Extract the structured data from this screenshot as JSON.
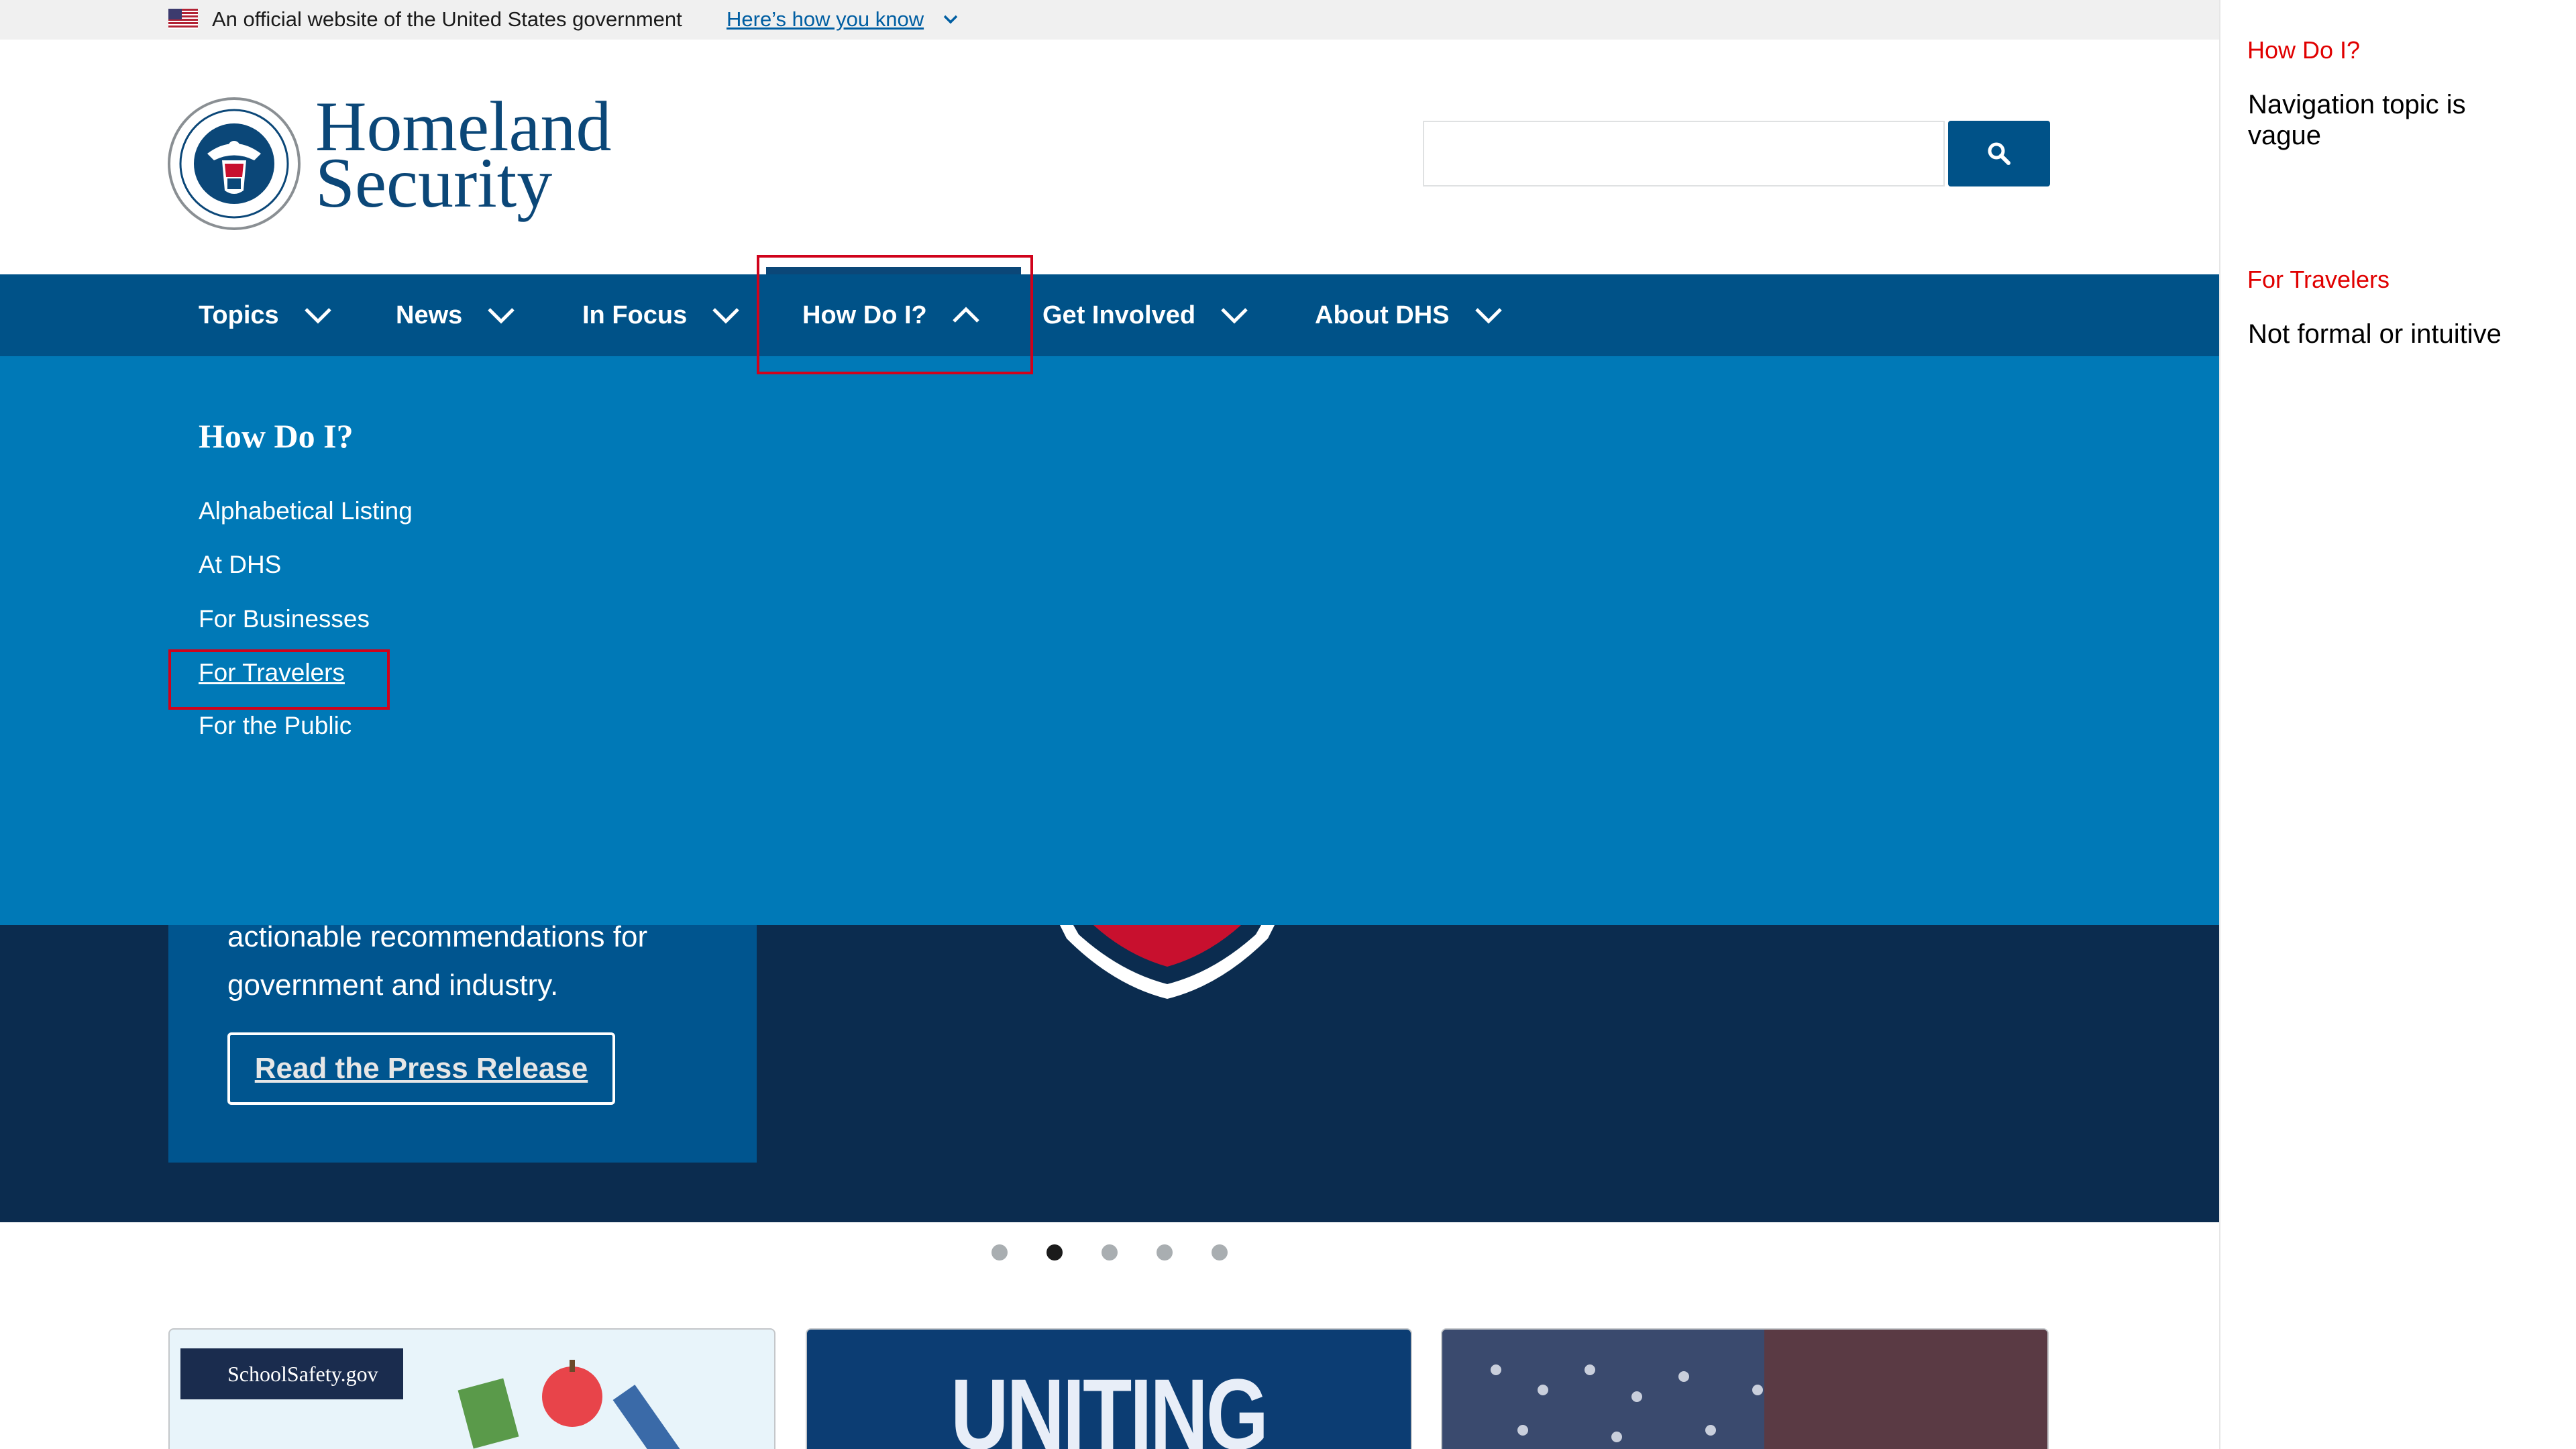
{
  "gov_banner": {
    "text": "An official website of the United States government",
    "link": "Here’s how you know"
  },
  "header": {
    "logo_line1": "Homeland",
    "logo_line2": "Security",
    "search": {
      "value": "",
      "placeholder": ""
    }
  },
  "nav": {
    "items": [
      {
        "label": "Topics"
      },
      {
        "label": "News"
      },
      {
        "label": "In Focus"
      },
      {
        "label": "How Do I?"
      },
      {
        "label": "Get Involved"
      },
      {
        "label": "About DHS"
      }
    ]
  },
  "dropdown": {
    "title": "How Do I?",
    "links": [
      "Alphabetical Listing",
      "At DHS",
      "For Businesses",
      "For Travelers",
      "For the Public"
    ]
  },
  "hero": {
    "text_line1": "actionable recommendations for",
    "text_line2": "government and industry.",
    "button_label": "Read the Press Release"
  },
  "carousel": {
    "total": 5,
    "active_index": 1
  },
  "cards": {
    "card1_badge": "SchoolSafety.gov",
    "card2_text": "UNITING"
  },
  "annotations": [
    {
      "title": "How Do I?",
      "body": "Navigation topic is vague"
    },
    {
      "title": "For Travelers",
      "body": "Not formal or intuitive"
    }
  ],
  "colors": {
    "nav_bg": "#005288",
    "dropdown_bg": "#0079b7",
    "hero_bg": "#0b2c4f",
    "annotation_red": "#e00000"
  }
}
